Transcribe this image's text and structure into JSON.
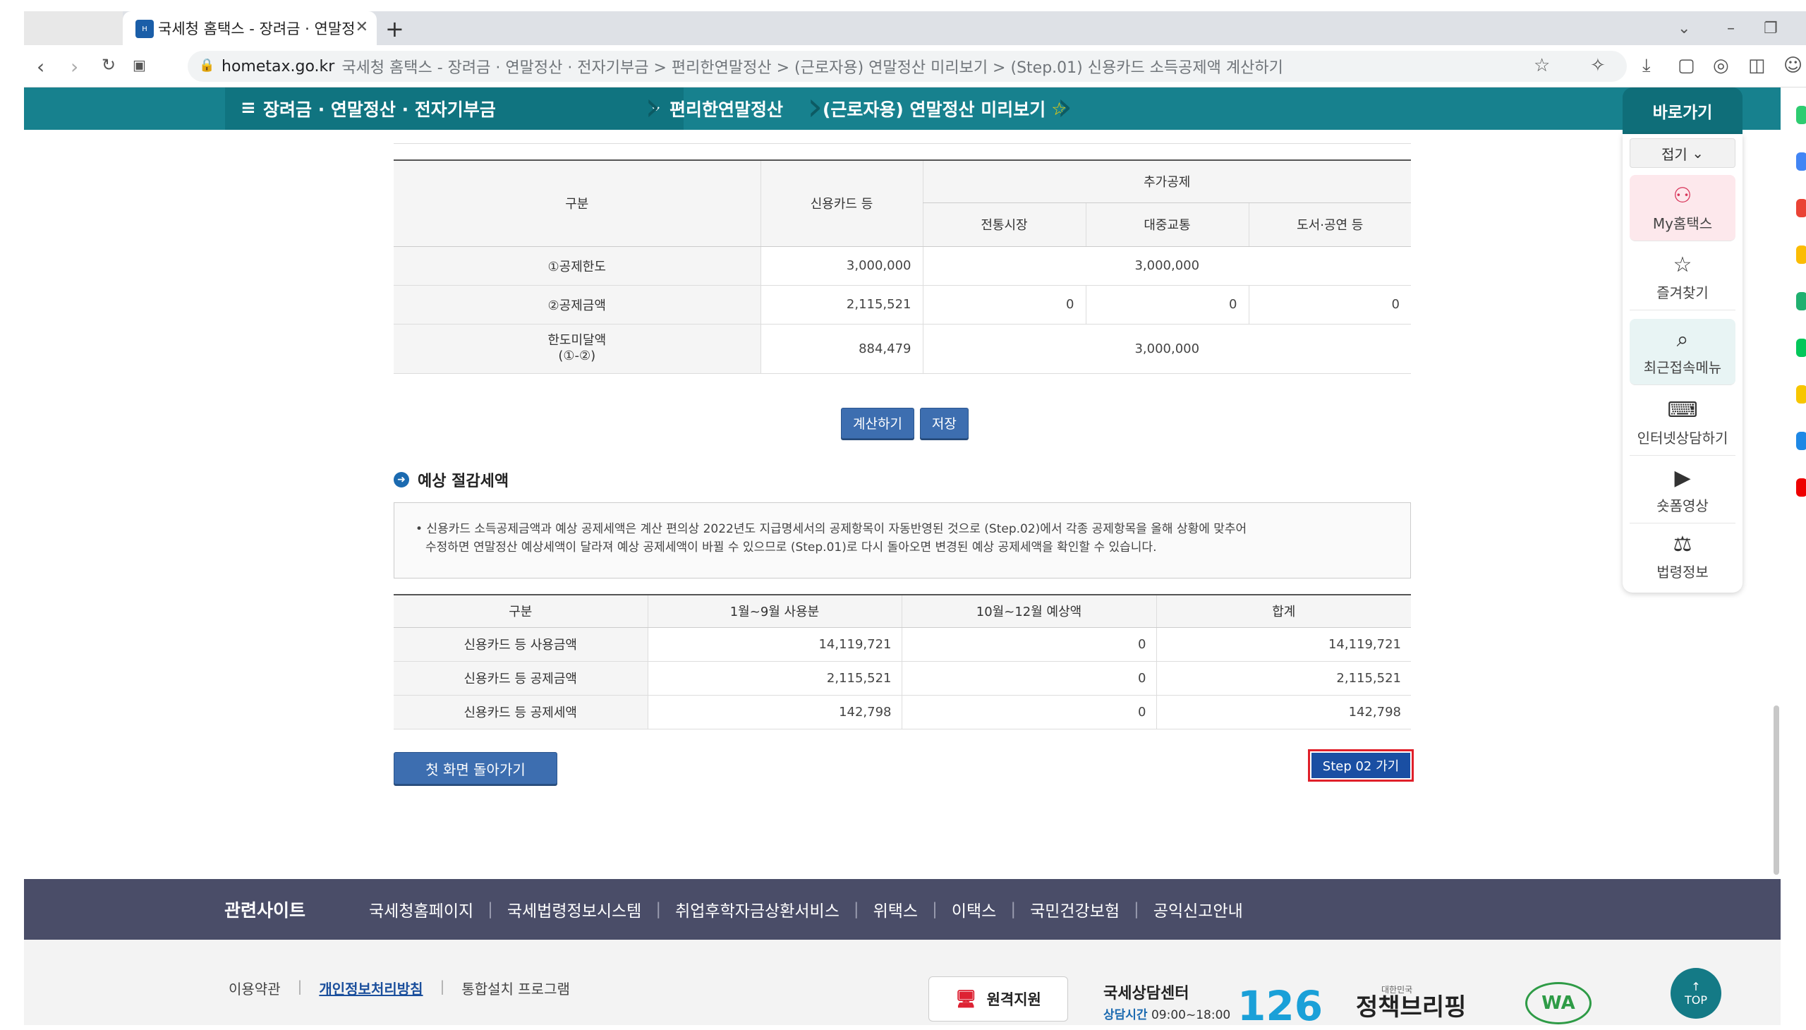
{
  "browser": {
    "tab_title": "국세청 홈택스 - 장려금 · 연말정",
    "url_host": "hometax.go.kr",
    "url_path": "국세청 홈택스 - 장려금 · 연말정산 · 전자기부금 > 편리한연말정산 > (근로자용) 연말정산 미리보기 > (Step.01) 신용카드 소득공제액 계산하기"
  },
  "gnb": {
    "menu": "장려금 · 연말정산 · 전자기부금",
    "crumb1": "편리한연말정산",
    "crumb2": "(근로자용) 연말정산 미리보기",
    "quick_title": "바로가기"
  },
  "quick": {
    "fold": "접기",
    "items": [
      "My홈택스",
      "즐겨찾기",
      "최근접속메뉴",
      "인터넷상담하기",
      "숏폼영상",
      "법령정보"
    ]
  },
  "table1": {
    "headers": {
      "col1": "구분",
      "col2": "신용카드 등",
      "extra": "추가공제",
      "sub1": "전통시장",
      "sub2": "대중교통",
      "sub3": "도서·공연 등"
    },
    "rows": [
      {
        "label": "①공제한도",
        "card": "3,000,000",
        "extra": "3,000,000"
      },
      {
        "label": "②공제금액",
        "card": "2,115,521",
        "market": "0",
        "transit": "0",
        "books": "0"
      },
      {
        "label": "한도미달액",
        "label2": "(①-②)",
        "card": "884,479",
        "extra": "3,000,000"
      }
    ]
  },
  "buttons": {
    "calc": "계산하기",
    "save": "저장",
    "home": "첫 화면 돌아가기",
    "step2": "Step 02 가기"
  },
  "section": {
    "title": "예상 절감세액",
    "note1": "• 신용카드 소득공제금액과 예상 공제세액은 계산 편의상 2022년도 지급명세서의 공제항목이 자동반영된 것으로 (Step.02)에서 각종 공제항목을 올해 상황에 맞추어",
    "note2": "수정하면 연말정산 예상세액이 달라져 예상 공제세액이 바뀔 수 있으므로 (Step.01)로 다시 돌아오면 변경된 예상 공제세액을 확인할 수 있습니다."
  },
  "table2": {
    "headers": [
      "구분",
      "1월~9월 사용분",
      "10월~12월 예상액",
      "합계"
    ],
    "rows": [
      [
        "신용카드 등 사용금액",
        "14,119,721",
        "0",
        "14,119,721"
      ],
      [
        "신용카드 등 공제금액",
        "2,115,521",
        "0",
        "2,115,521"
      ],
      [
        "신용카드 등 공제세액",
        "142,798",
        "0",
        "142,798"
      ]
    ]
  },
  "footer": {
    "title": "관련사이트",
    "links": [
      "국세청홈페이지",
      "국세법령정보시스템",
      "취업후학자금상환서비스",
      "위택스",
      "이택스",
      "국민건강보험",
      "공익신고안내"
    ],
    "bottom_links": [
      "이용약관",
      "개인정보처리방침",
      "통합설치 프로그램"
    ],
    "remote": "원격지원",
    "center": "국세상담센터",
    "center_hours_label": "상담시간",
    "center_hours": "09:00~18:00",
    "number": "126",
    "brief_small": "대한민국",
    "brief": "정책브리핑",
    "wa": "WA",
    "top": "TOP"
  }
}
